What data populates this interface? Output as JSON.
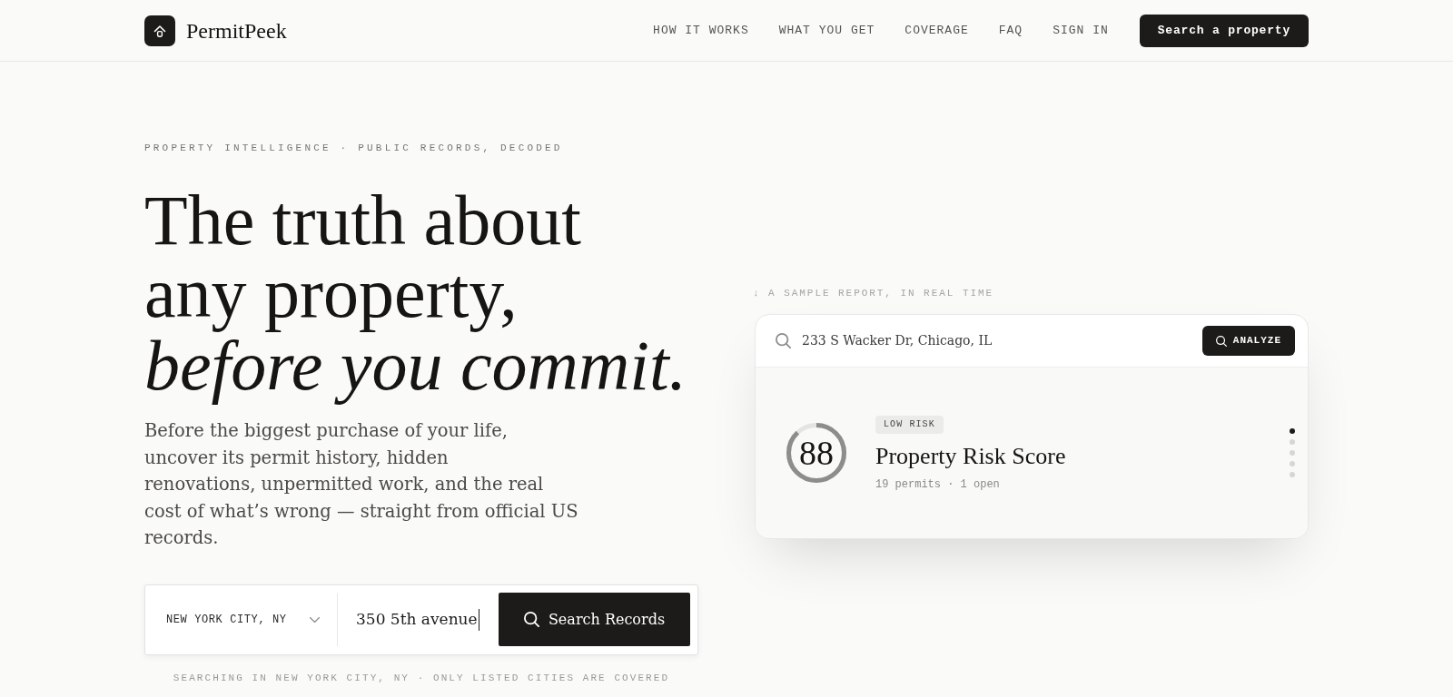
{
  "header": {
    "brand": "PermitPeek",
    "nav": [
      {
        "label": "HOW IT WORKS"
      },
      {
        "label": "WHAT YOU GET"
      },
      {
        "label": "COVERAGE"
      },
      {
        "label": "FAQ"
      },
      {
        "label": "SIGN IN"
      }
    ],
    "cta": "Search a property"
  },
  "hero": {
    "eyebrow": "PROPERTY INTELLIGENCE · PUBLIC RECORDS, DECODED",
    "headline": "The truth about\nany property,\n*before you commit.*",
    "intro": "Before the biggest purchase of your life,\nuncover its permit history, hidden\nrenovations, unpermitted work, and the real\ncost of what’s wrong — straight from official US\nrecords.",
    "search": {
      "city": "NEW YORK CITY, NY",
      "query": {
        "value": "350 5th avenue",
        "focused": true
      },
      "button": "Search Records",
      "note": "SEARCHING IN NEW YORK CITY, NY · ONLY LISTED CITIES ARE COVERED"
    }
  },
  "sample": {
    "caption": "↓ A SAMPLE REPORT, IN REAL TIME",
    "search": {
      "value": "233 S Wacker Dr, Chicago, IL",
      "button": "ANALYZE"
    },
    "report": {
      "score": "88",
      "level": 0.88,
      "badge": "LOW RISK",
      "title": "Property Risk Score",
      "details": "19 permits · 1 open"
    },
    "slides": [
      {
        "selected": true
      },
      {
        "selected": false
      },
      {
        "selected": false
      },
      {
        "selected": false
      },
      {
        "selected": false
      }
    ]
  }
}
